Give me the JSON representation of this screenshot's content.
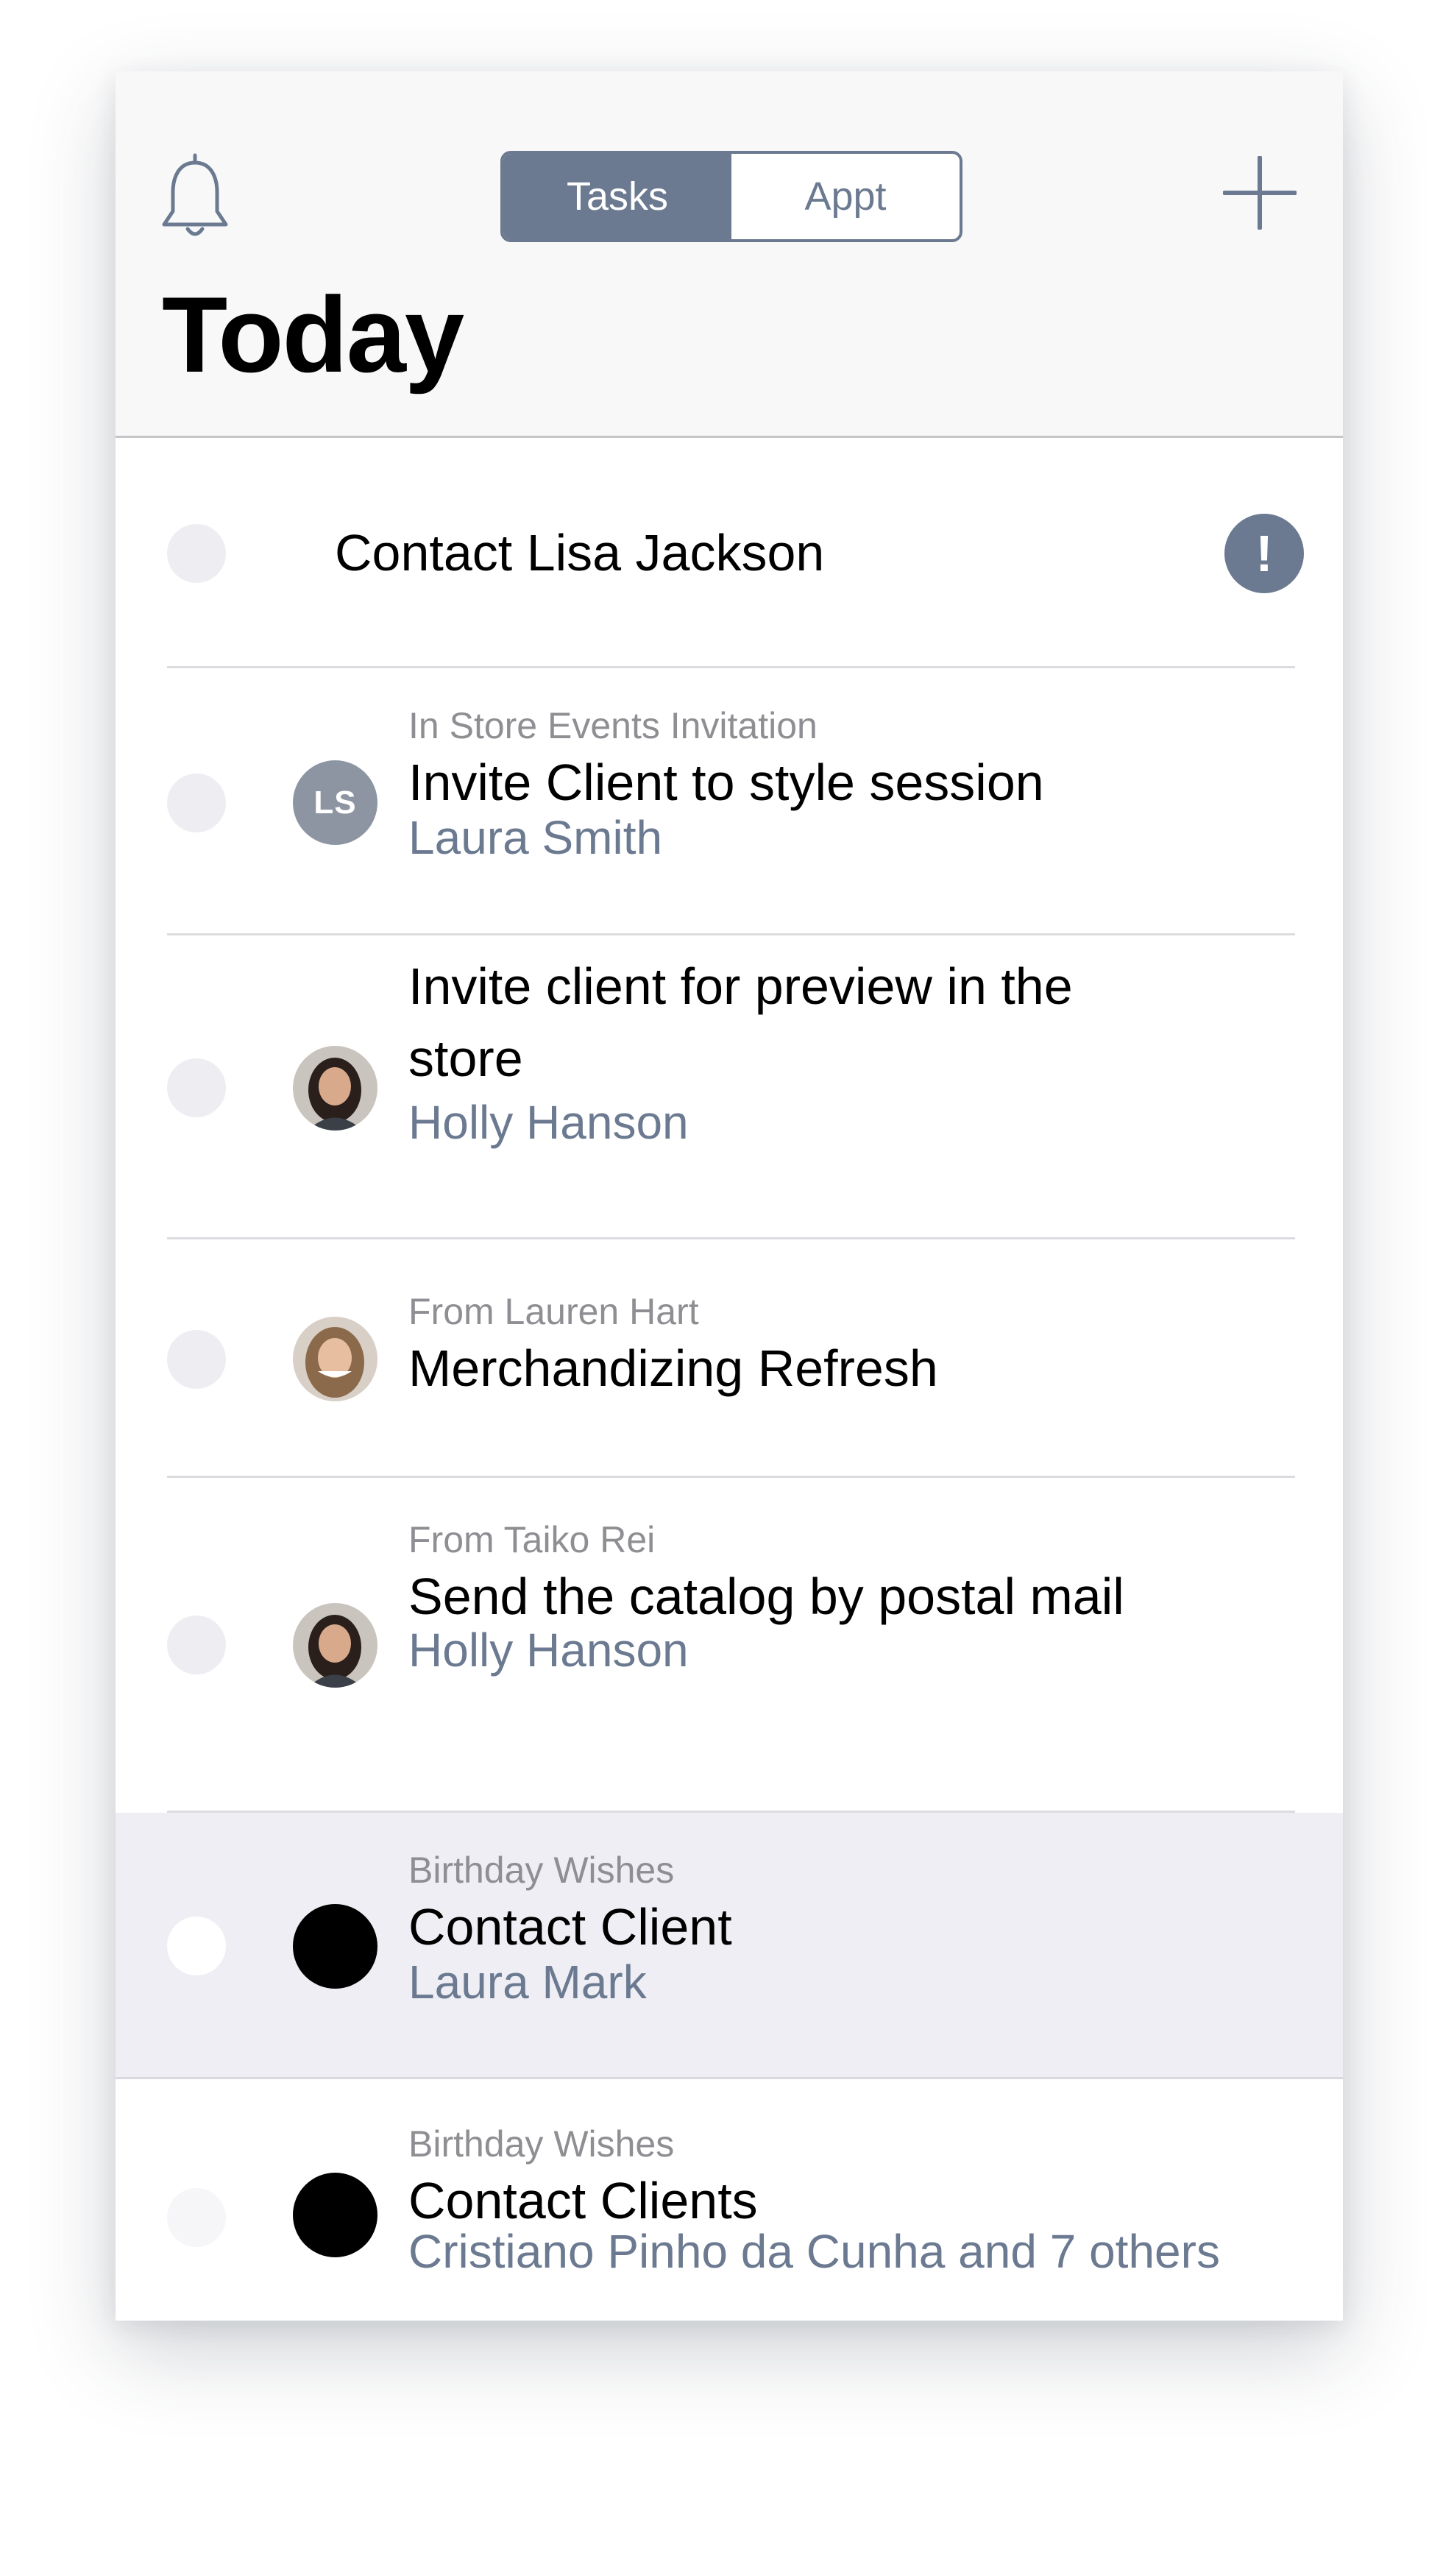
{
  "header": {
    "tabs": [
      {
        "label": "Tasks",
        "active": true
      },
      {
        "label": "Appt",
        "active": false
      }
    ],
    "title": "Today",
    "icons": {
      "left": "bell-icon",
      "right": "plus-icon"
    }
  },
  "tasks": [
    {
      "category": "",
      "title": "Contact Lisa Jackson",
      "assignee": "",
      "avatar": "none",
      "priority": "high",
      "priority_symbol": "!"
    },
    {
      "category": "In Store Events Invitation",
      "title": "Invite Client to style session",
      "assignee": "Laura Smith",
      "avatar": "initials",
      "avatar_initials": "LS"
    },
    {
      "category": "",
      "title": "Invite client for preview in the store",
      "assignee": "Holly Hanson",
      "avatar": "photo"
    },
    {
      "category": "From Lauren Hart",
      "title": "Merchandizing Refresh",
      "assignee": "",
      "avatar": "photo"
    },
    {
      "category": "From Taiko Rei",
      "title": "Send the catalog by postal mail",
      "assignee": "Holly Hanson",
      "avatar": "photo"
    },
    {
      "category": "Birthday Wishes",
      "title": "Contact Client",
      "assignee": "Laura Mark",
      "avatar": "black",
      "selected": true
    },
    {
      "category": "Birthday Wishes",
      "title": "Contact Clients",
      "assignee": "Cristiano Pinho da Cunha and 7 others",
      "avatar": "black"
    }
  ],
  "colors": {
    "accent": "#6b7a90",
    "header_bg": "#f8f8f8",
    "highlight_bg": "#eeeef4",
    "secondary_text": "#8e8e93"
  }
}
